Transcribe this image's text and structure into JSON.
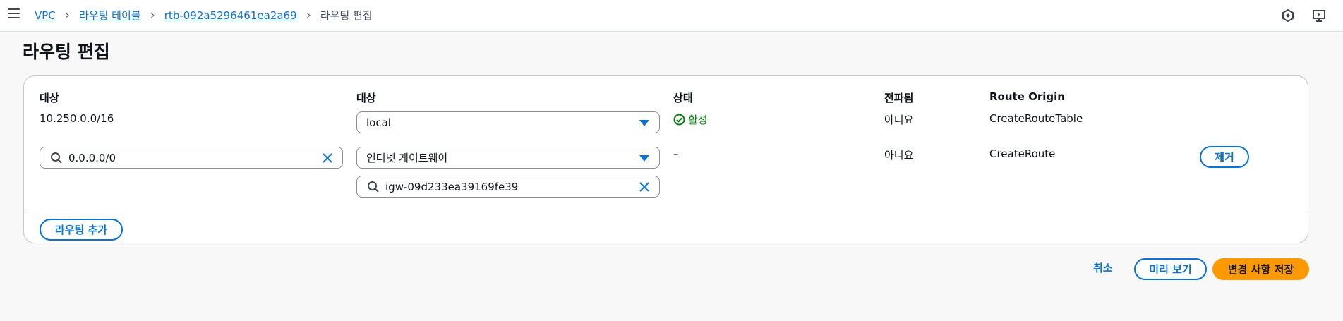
{
  "breadcrumb": {
    "items": [
      "VPC",
      "라우팅 테이블",
      "rtb-092a5296461ea2a69"
    ],
    "current": "라우팅 편집"
  },
  "page": {
    "title": "라우팅 편집"
  },
  "table": {
    "headers": {
      "destination": "대상",
      "target": "대상",
      "status": "상태",
      "propagated": "전파됨",
      "route_origin": "Route Origin"
    },
    "rows": [
      {
        "destination": "10.250.0.0/16",
        "target": "local",
        "status": "활성",
        "propagated": "아니요",
        "route_origin": "CreateRouteTable"
      },
      {
        "destination": "0.0.0.0/0",
        "target": "인터넷 게이트웨이",
        "target_id": "igw-09d233ea39169fe39",
        "status": "–",
        "propagated": "아니요",
        "route_origin": "CreateRoute",
        "remove_label": "제거"
      }
    ],
    "add_route_label": "라우팅 추가"
  },
  "footer": {
    "cancel_label": "취소",
    "preview_label": "미리 보기",
    "save_label": "변경 사항 저장"
  },
  "colors": {
    "link": "#0972d3",
    "primary_button": "#ff9900",
    "success": "#037f0c"
  }
}
